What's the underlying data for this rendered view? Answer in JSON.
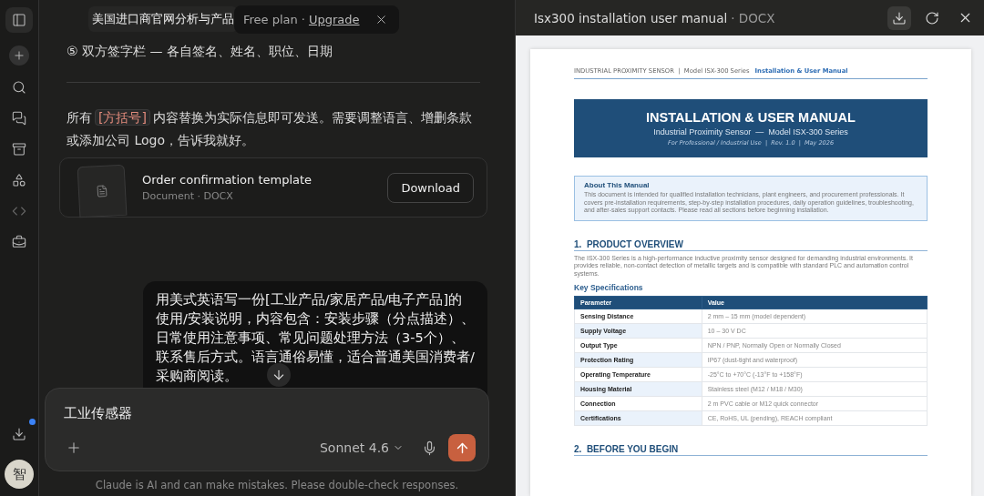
{
  "sidebar": {
    "items": [
      {
        "kind": "panel"
      },
      {
        "kind": "new"
      },
      {
        "kind": "search"
      },
      {
        "kind": "chats"
      },
      {
        "kind": "projects"
      },
      {
        "kind": "artifacts"
      },
      {
        "kind": "code"
      },
      {
        "kind": "toolbox"
      }
    ],
    "download_badge": true,
    "avatar": "智"
  },
  "chat": {
    "title": "美国进口商官网分析与产品",
    "plan_popup": {
      "plan": "Free plan",
      "separator": "·",
      "link": "Upgrade"
    },
    "item_line": "⑤ 双方签字栏 — 各自签名、姓名、职位、日期",
    "note": {
      "before": "所有",
      "tag": "[方括号]",
      "after": "内容替换为实际信息即可发送。需要调整语言、增删条款或添加公司 Logo，告诉我就好。"
    },
    "file_card": {
      "name": "Order confirmation template",
      "meta": "Document · DOCX",
      "button": "Download"
    },
    "user_message": "用美式英语写一份[工业产品/家居产品/电子产品]的使用/安装说明，内容包含：安装步骤（分点描述）、日常使用注意事项、常见问题处理方法（3-5个）、联系售后方式。语言通俗易懂，适合普通美国消费者/采购商阅读。",
    "input": {
      "value": "工业传感器",
      "model": "Sonnet 4.6"
    },
    "disclaimer": "Claude is AI and can make mistakes. Please double-check responses."
  },
  "preview": {
    "title": "Isx300 installation user manual",
    "format": "· DOCX",
    "doc": {
      "header": {
        "left": "INDUSTRIAL PROXIMITY SENSOR  |  Model ISX-300 Series",
        "right": "Installation & User Manual"
      },
      "banner": {
        "title": "INSTALLATION & USER MANUAL",
        "subtitle": "Industrial Proximity Sensor  —  Model ISX-300 Series",
        "meta": "For Professional / Industrial Use  |  Rev. 1.0  |  May 2026"
      },
      "about": {
        "title": "About This Manual",
        "text": "This document is intended for qualified installation technicians, plant engineers, and procurement professionals. It covers pre-installation requirements, step-by-step installation procedures, daily operation guidelines, troubleshooting, and after-sales support contacts. Please read all sections before beginning installation."
      },
      "section1": {
        "heading": "1.  PRODUCT OVERVIEW",
        "text": "The ISX-300 Series is a high-performance inductive proximity sensor designed for demanding industrial environments. It provides reliable, non-contact detection of metallic targets and is compatible with standard PLC and automation control systems.",
        "subheading": "Key Specifications"
      },
      "table": {
        "columns": [
          "Parameter",
          "Value"
        ],
        "rows": [
          [
            "Sensing Distance",
            "2 mm – 15 mm (model dependent)"
          ],
          [
            "Supply Voltage",
            "10 – 30 V DC"
          ],
          [
            "Output Type",
            "NPN / PNP, Normally Open or Normally Closed"
          ],
          [
            "Protection Rating",
            "IP67 (dust-tight and waterproof)"
          ],
          [
            "Operating Temperature",
            "-25°C to +70°C (-13°F to +158°F)"
          ],
          [
            "Housing Material",
            "Stainless steel (M12 / M18 / M30)"
          ],
          [
            "Connection",
            "2 m PVC cable or M12 quick connector"
          ],
          [
            "Certifications",
            "CE, RoHS, UL (pending), REACH compliant"
          ]
        ]
      },
      "section2": {
        "heading": "2.  BEFORE YOU BEGIN"
      }
    }
  }
}
